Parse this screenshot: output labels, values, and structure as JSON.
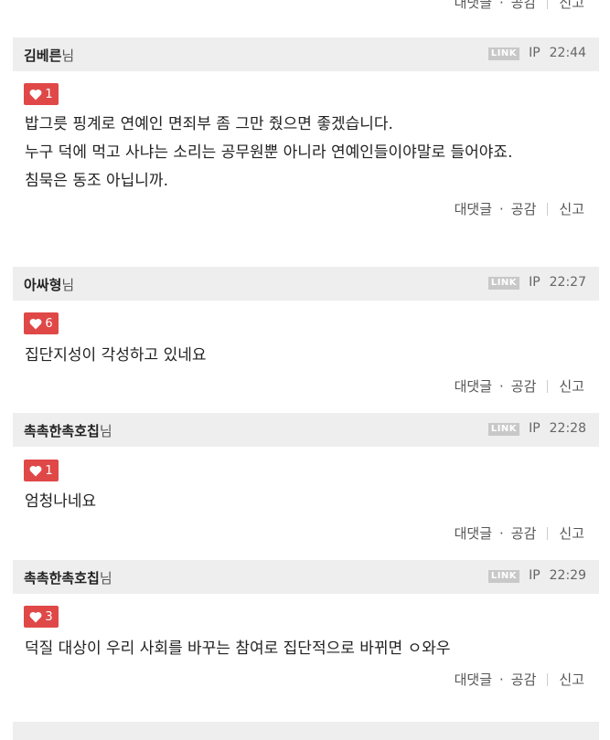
{
  "actions": {
    "reply": "대댓글",
    "like": "공감",
    "report": "신고"
  },
  "badge_text": "LINK",
  "ip_label": "IP",
  "nim_suffix": "님",
  "comments": [
    {
      "author": "김베른",
      "time": "22:44",
      "likes": "1",
      "lines": [
        "밥그릇 핑계로 연예인 면죄부 좀 그만 줬으면 좋겠습니다.",
        "누구 덕에 먹고 사냐는 소리는 공무원뿐 아니라 연예인들이야말로 들어야죠.",
        "침묵은 동조 아닙니까."
      ]
    },
    {
      "author": "아싸형",
      "time": "22:27",
      "likes": "6",
      "lines": [
        "집단지성이 각성하고 있네요"
      ]
    },
    {
      "author": "촉촉한촉호칩",
      "time": "22:28",
      "likes": "1",
      "lines": [
        "엄청나네요"
      ]
    },
    {
      "author": "촉촉한촉호칩",
      "time": "22:29",
      "likes": "3",
      "lines": [
        "덕질 대상이 우리 사회를 바꾸는 참여로 집단적으로 바뀌면 ㅇ와우"
      ]
    }
  ],
  "colors": {
    "heart_badge": "#e04848",
    "header_bg": "#eeeeee",
    "link_badge": "#c8c8c8"
  }
}
